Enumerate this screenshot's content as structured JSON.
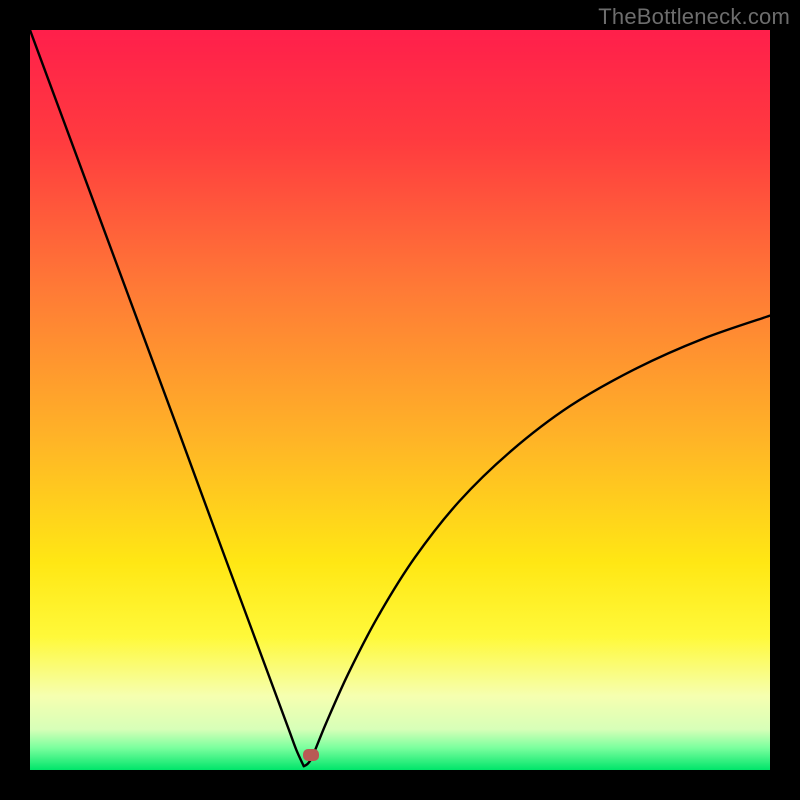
{
  "watermark": {
    "text": "TheBottleneck.com"
  },
  "colors": {
    "black": "#000000",
    "curve": "#000000",
    "marker": "#b85a55"
  },
  "gradient_stops": [
    {
      "offset": 0.0,
      "color": "#ff1f4b"
    },
    {
      "offset": 0.15,
      "color": "#ff3b3f"
    },
    {
      "offset": 0.35,
      "color": "#ff7a36"
    },
    {
      "offset": 0.55,
      "color": "#ffb327"
    },
    {
      "offset": 0.72,
      "color": "#ffe714"
    },
    {
      "offset": 0.82,
      "color": "#fff93a"
    },
    {
      "offset": 0.9,
      "color": "#f6ffb0"
    },
    {
      "offset": 0.945,
      "color": "#d7ffb8"
    },
    {
      "offset": 0.97,
      "color": "#7bff9e"
    },
    {
      "offset": 1.0,
      "color": "#00e56a"
    }
  ],
  "chart_data": {
    "type": "line",
    "title": "",
    "xlabel": "",
    "ylabel": "",
    "xlim": [
      0,
      100
    ],
    "ylim": [
      0,
      100
    ],
    "min_x": 37,
    "marker": {
      "x": 38,
      "y": 2
    },
    "series": [
      {
        "name": "curve",
        "x": [
          0,
          5,
          10,
          15,
          20,
          25,
          30,
          33,
          35,
          36,
          37,
          38,
          40,
          43,
          47,
          52,
          58,
          65,
          73,
          82,
          91,
          100
        ],
        "y": [
          100,
          86.5,
          73,
          59.5,
          46,
          32.4,
          18.9,
          10.8,
          5.4,
          2.7,
          0.5,
          1.5,
          6.3,
          13.0,
          20.7,
          28.7,
          36.3,
          43.1,
          49.2,
          54.3,
          58.3,
          61.4
        ]
      }
    ]
  }
}
